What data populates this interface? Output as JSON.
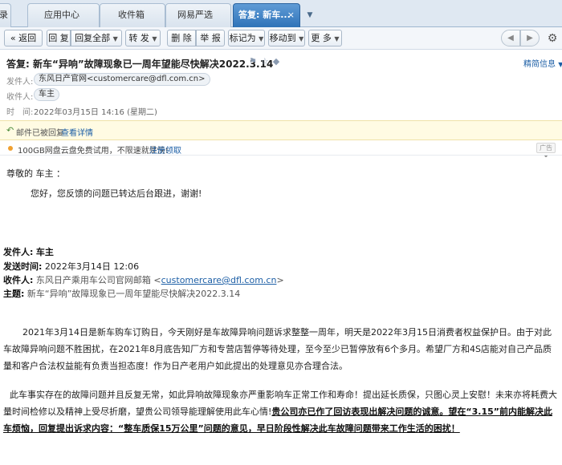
{
  "tabs": [
    {
      "label": "录"
    },
    {
      "label": "应用中心"
    },
    {
      "label": "收件箱"
    },
    {
      "label": "网易严选"
    },
    {
      "label": "答复: 新车...",
      "close": "×"
    }
  ],
  "toolbar": {
    "back": "« 返回",
    "reply": "回 复",
    "reply_all": "回复全部",
    "forward": "转 发",
    "delete": "删 除",
    "report": "举 报",
    "mark_as": "标记为",
    "move_to": "移动到",
    "more": "更 多"
  },
  "header": {
    "subject": "答复: 新车“异响”故障现象已一周年望能尽快解决2022.3.14",
    "fine_info": "精简信息",
    "from_label": "发件人:",
    "from_value": "东风日产官网<customercare@dfl.com.cn>",
    "to_label": "收件人:",
    "to_value": "车主",
    "time_label": "时　间:",
    "time_value": "2022年03月15日 14:16 (星期二)"
  },
  "notice": {
    "text": "邮件已被回复",
    "link": "查看详情"
  },
  "ad": {
    "text": "100GB网盘云盘免费试用，不限速就是快!",
    "link": "注册领取",
    "tag": "广告"
  },
  "body": {
    "greeting": "尊敬的 车主 ：",
    "reply": "您好，您反馈的问题已转达后台跟进，谢谢!",
    "quote": {
      "from_label": "发件人:",
      "from_value": "车主",
      "sent_label": "发送时间:",
      "sent_value": "2022年3月14日 12:06",
      "to_label": "收件人:",
      "to_value_prefix": "东风日产乘用车公司官网邮箱 <",
      "to_value_email": "customercare@dfl.com.cn",
      "to_value_suffix": ">",
      "subject_label": "主题:",
      "subject_value": "新车“异响”故障现象已一周年望能尽快解决2022.3.14"
    },
    "para1": "2021年3月14日是新车购车订购日，今天刚好是车故障异响问题诉求整整一周年，明天是2022年3月15日消费者权益保护日。由于对此车故障异响问题不胜困扰，在2021年8月底告知厂方和专营店暂停等待处理，至今至少已暂停放有6个多月。希望厂方和4S店能对自己产品质量和客户合法权益能有负责当担态度！作为日产老用户如此提出的处理意见亦合理合法。",
    "para2_plain": "此车事实存在的故障问题并且反复无常，如此异响故障现象亦严重影响车正常工作和寿命！提出延长质保，只图心灵上安慰！未来亦将耗费大量时间检修以及精神上受尽折磨，望贵公司领导能理解使用此车心情!",
    "para2_bold": "贵公司亦已作了回访表现出解决问题的诚意。望在“3.15”前内能解决此车烦恼，回复提出诉求内容：“整车质保15万公里”问题的意见，早日阶段性解决此车故障问题带来工作生活的困扰！"
  }
}
